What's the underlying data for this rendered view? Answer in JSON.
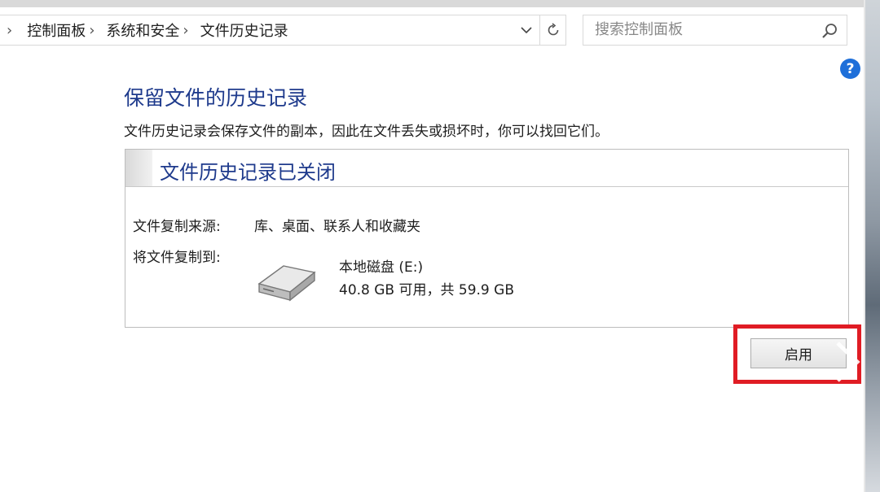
{
  "breadcrumb": {
    "items": [
      "控制面板",
      "系统和安全",
      "文件历史记录"
    ]
  },
  "search": {
    "placeholder": "搜索控制面板"
  },
  "help": {
    "label": "?"
  },
  "content": {
    "title": "保留文件的历史记录",
    "description": "文件历史记录会保存文件的副本，因此在文件丢失或损坏时，你可以找回它们。"
  },
  "panel": {
    "status_title": "文件历史记录已关闭",
    "source_label": "文件复制来源:",
    "source_value": "库、桌面、联系人和收藏夹",
    "target_label": "将文件复制到:",
    "drive_name": "本地磁盘 (E:)",
    "drive_space": "40.8 GB 可用，共 59.9 GB"
  },
  "actions": {
    "enable_label": "启用"
  },
  "colors": {
    "title_blue": "#1e3a8c",
    "highlight_red": "#e01c24",
    "help_blue": "#1e6fd9"
  },
  "icons": [
    "chevron-right-icon",
    "chevron-down-icon",
    "refresh-icon",
    "search-icon",
    "help-icon",
    "drive-icon"
  ]
}
